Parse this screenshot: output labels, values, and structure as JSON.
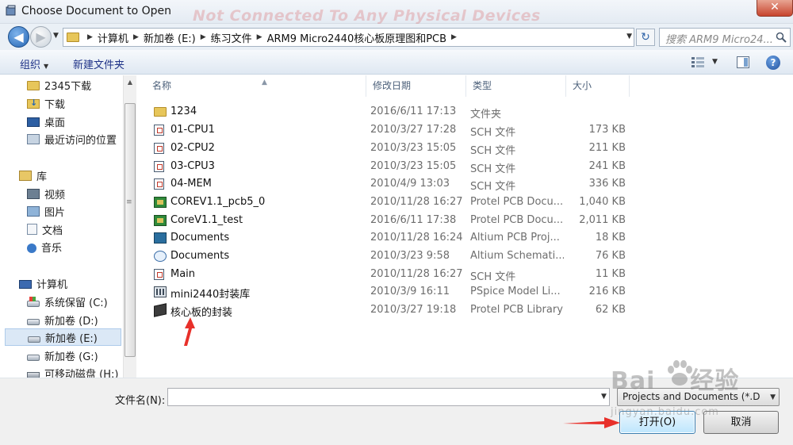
{
  "window": {
    "title": "Choose Document to Open",
    "watermark_top": "Not Connected To Any Physical Devices",
    "close_glyph": "✕"
  },
  "address": {
    "crumbs": [
      "计算机",
      "新加卷 (E:)",
      "练习文件",
      "ARM9 Micro2440核心板原理图和PCB"
    ],
    "search_placeholder": "搜索 ARM9 Micro24..."
  },
  "toolbar": {
    "organize_label": "组织",
    "new_folder_label": "新建文件夹"
  },
  "nav": {
    "items": [
      {
        "label": "2345下载",
        "icon": "folder-icon"
      },
      {
        "label": "下载",
        "icon": "downloads-icon"
      },
      {
        "label": "桌面",
        "icon": "desktop-icon"
      },
      {
        "label": "最近访问的位置",
        "icon": "recent-places-icon"
      },
      {
        "label": "库",
        "icon": "library-icon"
      },
      {
        "label": "视频",
        "icon": "videos-icon"
      },
      {
        "label": "图片",
        "icon": "pictures-icon"
      },
      {
        "label": "文档",
        "icon": "documents-icon"
      },
      {
        "label": "音乐",
        "icon": "music-icon"
      },
      {
        "label": "计算机",
        "icon": "computer-icon"
      },
      {
        "label": "系统保留 (C:)",
        "icon": "system-drive-icon"
      },
      {
        "label": "新加卷 (D:)",
        "icon": "drive-icon"
      },
      {
        "label": "新加卷 (E:)",
        "icon": "drive-icon",
        "selected": true
      },
      {
        "label": "新加卷 (G:)",
        "icon": "drive-icon"
      },
      {
        "label": "可移动磁盘 (H:)",
        "icon": "removable-drive-icon"
      }
    ]
  },
  "columns": {
    "name": "名称",
    "date": "修改日期",
    "type": "类型",
    "size": "大小"
  },
  "files": [
    {
      "name": "1234",
      "date": "2016/6/11 17:13",
      "type": "文件夹",
      "size": "",
      "icon": "folder-icon"
    },
    {
      "name": "01-CPU1",
      "date": "2010/3/27 17:28",
      "type": "SCH 文件",
      "size": "173 KB",
      "icon": "schematic-file-icon"
    },
    {
      "name": "02-CPU2",
      "date": "2010/3/23 15:05",
      "type": "SCH 文件",
      "size": "211 KB",
      "icon": "schematic-file-icon"
    },
    {
      "name": "03-CPU3",
      "date": "2010/3/23 15:05",
      "type": "SCH 文件",
      "size": "241 KB",
      "icon": "schematic-file-icon"
    },
    {
      "name": "04-MEM",
      "date": "2010/4/9 13:03",
      "type": "SCH 文件",
      "size": "336 KB",
      "icon": "schematic-file-icon"
    },
    {
      "name": "COREV1.1_pcb5_0",
      "date": "2010/11/28 16:27",
      "type": "Protel PCB Docu...",
      "size": "1,040 KB",
      "icon": "pcb-file-icon"
    },
    {
      "name": "CoreV1.1_test",
      "date": "2016/6/11 17:38",
      "type": "Protel PCB Docu...",
      "size": "2,011 KB",
      "icon": "pcb-file-icon"
    },
    {
      "name": "Documents",
      "date": "2010/11/28 16:24",
      "type": "Altium PCB Proj...",
      "size": "18 KB",
      "icon": "pcb-project-icon"
    },
    {
      "name": "Documents",
      "date": "2010/3/23 9:58",
      "type": "Altium Schemati...",
      "size": "76 KB",
      "icon": "schematic-doc-icon"
    },
    {
      "name": "Main",
      "date": "2010/11/28 16:27",
      "type": "SCH 文件",
      "size": "11 KB",
      "icon": "schematic-file-icon"
    },
    {
      "name": "mini2440封装库",
      "date": "2010/3/9 16:11",
      "type": "PSpice Model Li...",
      "size": "216 KB",
      "icon": "model-library-icon"
    },
    {
      "name": "核心板的封装",
      "date": "2010/3/27 19:18",
      "type": "Protel PCB Library",
      "size": "62 KB",
      "icon": "pcb-library-icon"
    }
  ],
  "bottom": {
    "filename_label": "文件名(N):",
    "filename_value": "",
    "filetype_value": "Projects and Documents (*.D",
    "open_label": "打开(O)",
    "cancel_label": "取消"
  },
  "watermark_bottom": {
    "brand_a": "Bai",
    "brand_b": "经验",
    "url": "jingyan.baidu.com"
  },
  "colors": {
    "annotation_arrow": "#e8302a",
    "selection_bg": "#dbe8f6",
    "link_text": "#1e3287"
  }
}
